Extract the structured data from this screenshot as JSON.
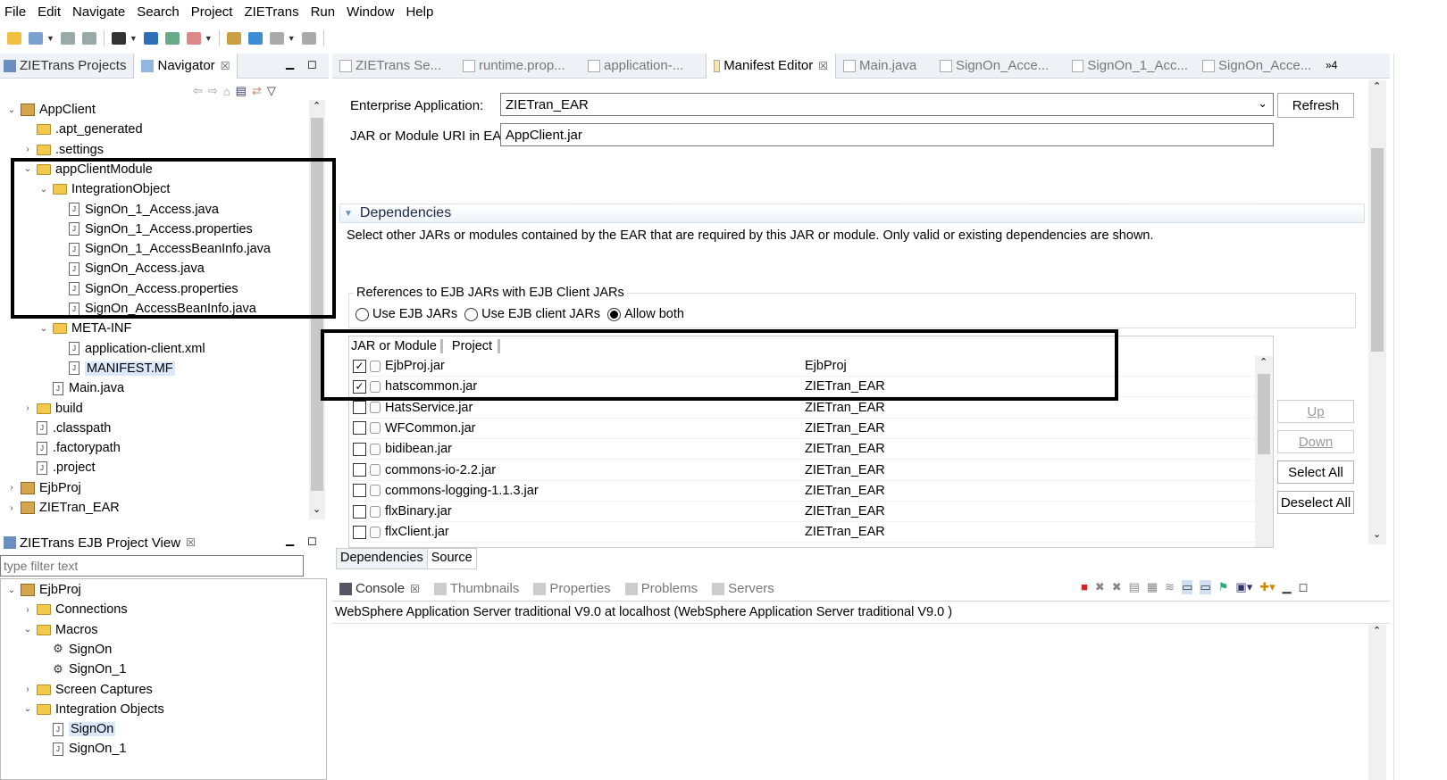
{
  "menu": [
    "File",
    "Edit",
    "Navigate",
    "Search",
    "Project",
    "ZIETrans",
    "Run",
    "Window",
    "Help"
  ],
  "toolbar_icons": [
    "new-icon",
    "new-wizard-icon",
    "save-icon",
    "save-all-icon",
    "print-icon",
    "run-icon",
    "debug-icon",
    "build-icon",
    "search-icon",
    "globe-icon",
    "back-icon",
    "forward-icon"
  ],
  "left_top": {
    "tabs": [
      {
        "label": "ZIETrans Projects"
      },
      {
        "label": "Navigator",
        "close": "☒"
      }
    ],
    "tree": [
      {
        "label": "AppClient",
        "indent": 0,
        "twisty": "⌄",
        "icon": "project"
      },
      {
        "label": ".apt_generated",
        "indent": 1,
        "twisty": "",
        "icon": "folder"
      },
      {
        "label": ".settings",
        "indent": 1,
        "twisty": "›",
        "icon": "folder"
      },
      {
        "label": "appClientModule",
        "indent": 1,
        "twisty": "⌄",
        "icon": "folder"
      },
      {
        "label": "IntegrationObject",
        "indent": 2,
        "twisty": "⌄",
        "icon": "folder"
      },
      {
        "label": "SignOn_1_Access.java",
        "indent": 3,
        "twisty": "",
        "icon": "file"
      },
      {
        "label": "SignOn_1_Access.properties",
        "indent": 3,
        "twisty": "",
        "icon": "file"
      },
      {
        "label": "SignOn_1_AccessBeanInfo.java",
        "indent": 3,
        "twisty": "",
        "icon": "file"
      },
      {
        "label": "SignOn_Access.java",
        "indent": 3,
        "twisty": "",
        "icon": "file"
      },
      {
        "label": "SignOn_Access.properties",
        "indent": 3,
        "twisty": "",
        "icon": "file"
      },
      {
        "label": "SignOn_AccessBeanInfo.java",
        "indent": 3,
        "twisty": "",
        "icon": "file"
      },
      {
        "label": "META-INF",
        "indent": 2,
        "twisty": "⌄",
        "icon": "folder"
      },
      {
        "label": "application-client.xml",
        "indent": 3,
        "twisty": "",
        "icon": "file"
      },
      {
        "label": "MANIFEST.MF",
        "indent": 3,
        "twisty": "",
        "icon": "file",
        "selected": true
      },
      {
        "label": "Main.java",
        "indent": 2,
        "twisty": "",
        "icon": "file"
      },
      {
        "label": "build",
        "indent": 1,
        "twisty": "›",
        "icon": "folder"
      },
      {
        "label": ".classpath",
        "indent": 1,
        "twisty": "",
        "icon": "file"
      },
      {
        "label": ".factorypath",
        "indent": 1,
        "twisty": "",
        "icon": "file"
      },
      {
        "label": ".project",
        "indent": 1,
        "twisty": "",
        "icon": "file"
      },
      {
        "label": "EjbProj",
        "indent": 0,
        "twisty": "›",
        "icon": "project"
      },
      {
        "label": "ZIETran_EAR",
        "indent": 0,
        "twisty": "›",
        "icon": "project"
      }
    ]
  },
  "left_bottom": {
    "tab": "ZIETrans EJB Project View",
    "close": "☒",
    "filter_placeholder": "type filter text",
    "tree": [
      {
        "label": "EjbProj",
        "indent": 0,
        "twisty": "⌄",
        "icon": "project"
      },
      {
        "label": "Connections",
        "indent": 1,
        "twisty": "›",
        "icon": "folder"
      },
      {
        "label": "Macros",
        "indent": 1,
        "twisty": "⌄",
        "icon": "folder"
      },
      {
        "label": "SignOn",
        "indent": 2,
        "twisty": "",
        "icon": "macro"
      },
      {
        "label": "SignOn_1",
        "indent": 2,
        "twisty": "",
        "icon": "macro"
      },
      {
        "label": "Screen Captures",
        "indent": 1,
        "twisty": "›",
        "icon": "folder"
      },
      {
        "label": "Integration Objects",
        "indent": 1,
        "twisty": "⌄",
        "icon": "folder"
      },
      {
        "label": "SignOn",
        "indent": 2,
        "twisty": "",
        "icon": "file",
        "selected": true
      },
      {
        "label": "SignOn_1",
        "indent": 2,
        "twisty": "",
        "icon": "file"
      }
    ]
  },
  "editor_tabs": [
    {
      "label": "ZIETrans Se...",
      "active": false
    },
    {
      "label": "runtime.prop...",
      "active": false
    },
    {
      "label": "application-...",
      "active": false
    },
    {
      "label": "Manifest Editor",
      "active": true,
      "close": "☒"
    },
    {
      "label": "Main.java",
      "active": false
    },
    {
      "label": "SignOn_Acce...",
      "active": false
    },
    {
      "label": "SignOn_1_Acc...",
      "active": false
    },
    {
      "label": "SignOn_Acce...",
      "active": false
    }
  ],
  "editor_overflow": "»4",
  "manifest": {
    "ear_label": "Enterprise Application:",
    "ear_value": "ZIETran_EAR",
    "refresh": "Refresh",
    "uri_label": "JAR or Module URI in EAR",
    "uri_value": "AppClient.jar",
    "section_title": "Dependencies",
    "section_desc": "Select other JARs or modules contained by the EAR that are required by this JAR or module.  Only valid or existing dependencies are shown.",
    "ejb_group_title": "References to EJB JARs with EJB Client JARs",
    "radios": [
      {
        "label": "Use EJB JARs",
        "checked": false
      },
      {
        "label": "Use EJB client JARs",
        "checked": false
      },
      {
        "label": "Allow both",
        "checked": true
      }
    ],
    "col_module": "JAR or Module",
    "col_project": "Project",
    "rows": [
      {
        "module": "EjbProj.jar",
        "project": "EjbProj",
        "checked": true
      },
      {
        "module": "hatscommon.jar",
        "project": "ZIETran_EAR",
        "checked": true
      },
      {
        "module": "HatsService.jar",
        "project": "ZIETran_EAR",
        "checked": false
      },
      {
        "module": "WFCommon.jar",
        "project": "ZIETran_EAR",
        "checked": false
      },
      {
        "module": "bidibean.jar",
        "project": "ZIETran_EAR",
        "checked": false
      },
      {
        "module": "commons-io-2.2.jar",
        "project": "ZIETran_EAR",
        "checked": false
      },
      {
        "module": "commons-logging-1.1.3.jar",
        "project": "ZIETran_EAR",
        "checked": false
      },
      {
        "module": "flxBinary.jar",
        "project": "ZIETran_EAR",
        "checked": false
      },
      {
        "module": "flxClient.jar",
        "project": "ZIETran_EAR",
        "checked": false
      }
    ],
    "buttons": {
      "up": "Up",
      "down": "Down",
      "select_all": "Select All",
      "deselect_all": "Deselect All"
    },
    "bottom_tabs": [
      "Dependencies",
      "Source"
    ]
  },
  "console": {
    "tabs": [
      {
        "label": "Console",
        "active": true,
        "close": "☒"
      },
      {
        "label": "Thumbnails",
        "active": false
      },
      {
        "label": "Properties",
        "active": false
      },
      {
        "label": "Problems",
        "active": false
      },
      {
        "label": "Servers",
        "active": false
      }
    ],
    "text": "WebSphere Application Server traditional V9.0 at localhost (WebSphere Application Server traditional V9.0 )"
  },
  "colors": {
    "accent": "#d9e8fb",
    "tab_bg": "#eef1f6",
    "folder": "#f2c94c",
    "stop": "#e02020"
  }
}
